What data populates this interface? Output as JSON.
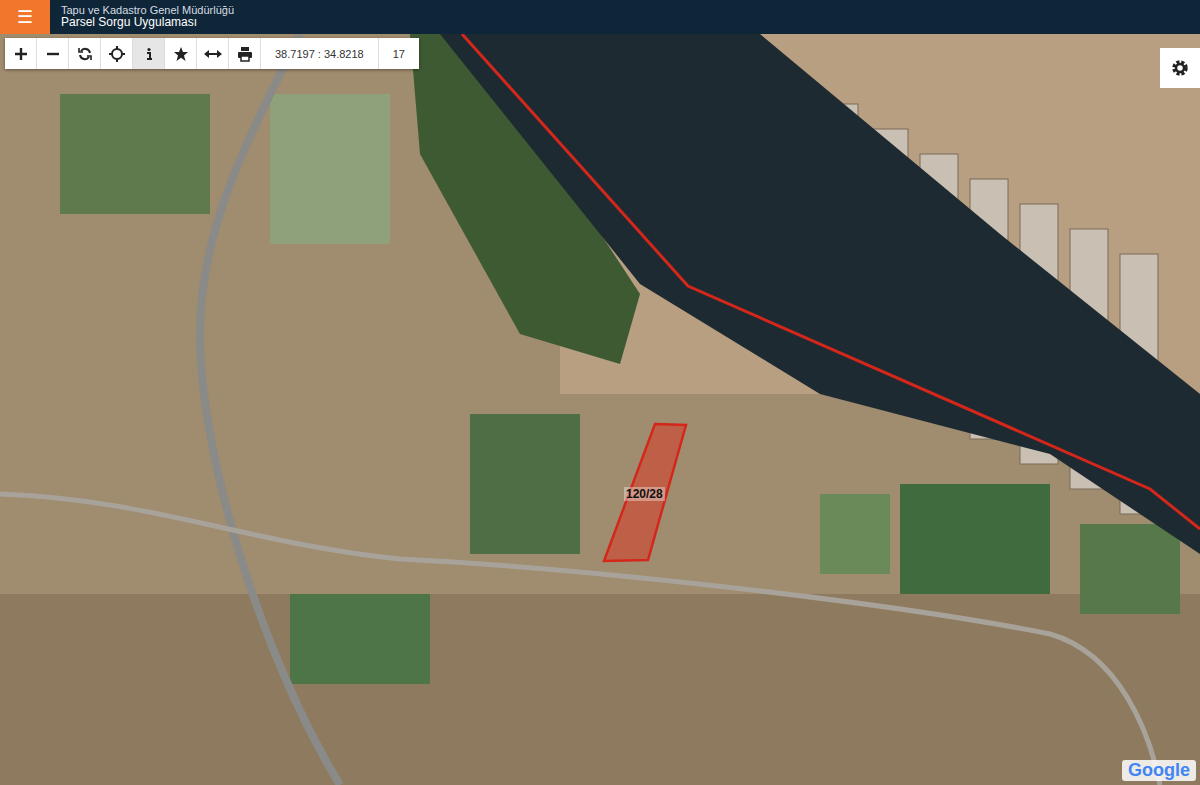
{
  "header": {
    "menu_icon": "☰",
    "title": "Tapu ve Kadastro Genel Müdürlüğü",
    "subtitle": "Parsel Sorgu Uygulaması"
  },
  "toolbar": {
    "coordinates": "38.7197 : 34.8218",
    "zoom": "17"
  },
  "map": {
    "parcel_label": "120/28",
    "attribution": "Google"
  }
}
